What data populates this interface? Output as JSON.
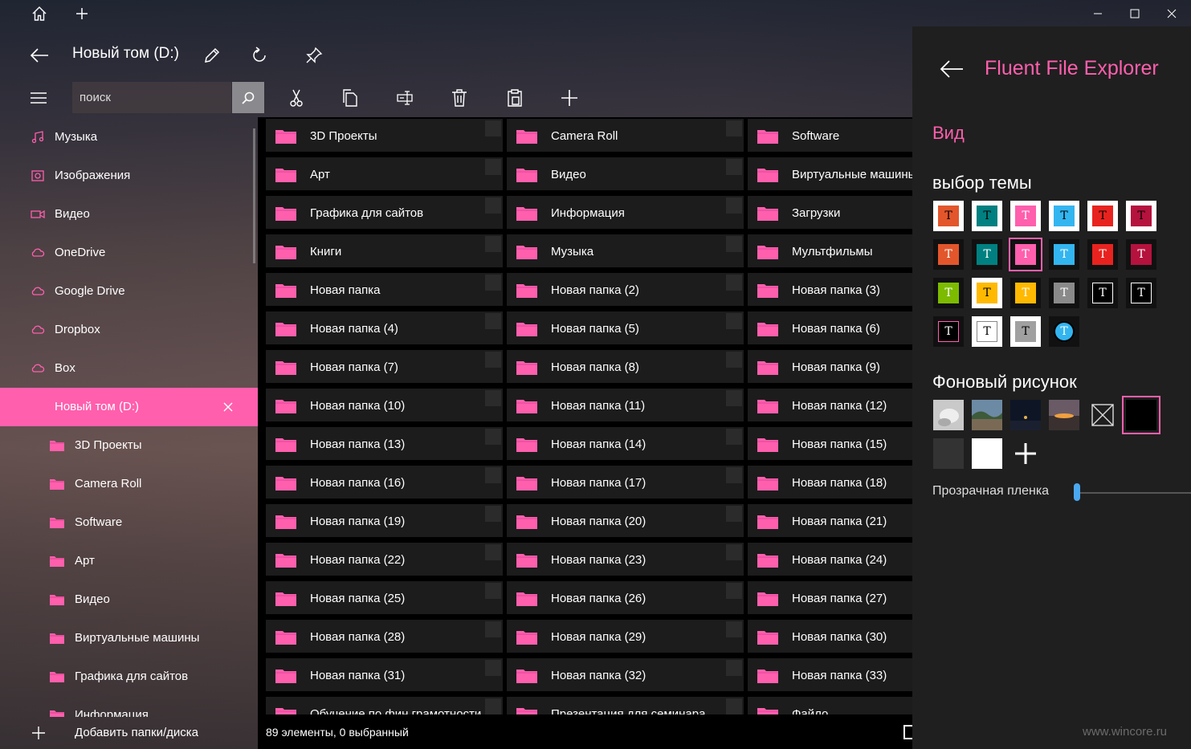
{
  "header": {
    "path_title": "Новый том (D:)"
  },
  "toolbar": {
    "search_placeholder": "поиск"
  },
  "sidebar": {
    "items": [
      {
        "label": "Музыка",
        "icon": "music-icon"
      },
      {
        "label": "Изображения",
        "icon": "pictures-icon"
      },
      {
        "label": "Видео",
        "icon": "video-icon"
      },
      {
        "label": "OneDrive",
        "icon": "cloud-icon"
      },
      {
        "label": "Google Drive",
        "icon": "cloud-icon"
      },
      {
        "label": "Dropbox",
        "icon": "cloud-icon"
      },
      {
        "label": "Box",
        "icon": "cloud-icon"
      },
      {
        "label": "Новый том (D:)",
        "icon": "drive-icon",
        "active": true
      },
      {
        "label": "3D Проекты",
        "icon": "folder-icon"
      },
      {
        "label": "Camera Roll",
        "icon": "folder-icon"
      },
      {
        "label": "Software",
        "icon": "folder-icon"
      },
      {
        "label": "Арт",
        "icon": "folder-icon"
      },
      {
        "label": "Видео",
        "icon": "folder-icon"
      },
      {
        "label": "Виртуальные машины",
        "icon": "folder-icon"
      },
      {
        "label": "Графика для сайтов",
        "icon": "folder-icon"
      },
      {
        "label": "Информация",
        "icon": "folder-icon"
      }
    ],
    "add_label": "Добавить папки/диска"
  },
  "folders": [
    "3D Проекты",
    "Camera Roll",
    "Software",
    "Арт",
    "Видео",
    "Виртуальные машины",
    "Графика для сайтов",
    "Информация",
    "Загрузки",
    "Книги",
    "Музыка",
    "Мультфильмы",
    "Новая папка",
    "Новая папка (2)",
    "Новая папка (3)",
    "Новая папка (4)",
    "Новая папка (5)",
    "Новая папка (6)",
    "Новая папка (7)",
    "Новая папка (8)",
    "Новая папка (9)",
    "Новая папка (10)",
    "Новая папка (11)",
    "Новая папка (12)",
    "Новая папка (13)",
    "Новая папка (14)",
    "Новая папка (15)",
    "Новая папка (16)",
    "Новая папка (17)",
    "Новая папка (18)",
    "Новая папка (19)",
    "Новая папка (20)",
    "Новая папка (21)",
    "Новая папка (22)",
    "Новая папка (23)",
    "Новая папка (24)",
    "Новая папка (25)",
    "Новая папка (26)",
    "Новая папка (27)",
    "Новая папка (28)",
    "Новая папка (29)",
    "Новая папка (30)",
    "Новая папка (31)",
    "Новая папка (32)",
    "Новая папка (33)",
    "Обучение по фин.грамотности",
    "Презентация для семинара",
    "Файло"
  ],
  "status": {
    "text": "89 элементы, 0 выбранный"
  },
  "panel": {
    "title": "Fluent File Explorer",
    "section": "Вид",
    "theme_heading": "выбор темы",
    "background_heading": "Фоновый рисунок",
    "transparency_label": "Прозрачная пленка",
    "transparency_value": 0.02,
    "watermark": "www.wincore.ru",
    "theme_glyph": "T",
    "themes": [
      {
        "bg": "#ffffff",
        "fill": "#e3562b",
        "text": "#000000"
      },
      {
        "bg": "#ffffff",
        "fill": "#008080",
        "text": "#000000"
      },
      {
        "bg": "#ffffff",
        "fill": "#ff5fad",
        "text": "#ffffff"
      },
      {
        "bg": "#ffffff",
        "fill": "#33b5f0",
        "text": "#000000"
      },
      {
        "bg": "#ffffff",
        "fill": "#e8231f",
        "text": "#000000"
      },
      {
        "bg": "#ffffff",
        "fill": "#b5123e",
        "text": "#000000"
      },
      {
        "bg": "#111111",
        "fill": "#e3562b",
        "text": "#ffffff"
      },
      {
        "bg": "#111111",
        "fill": "#008080",
        "text": "#ffffff"
      },
      {
        "bg": "#111111",
        "fill": "#ff5fad",
        "text": "#ffffff",
        "selected": true
      },
      {
        "bg": "#111111",
        "fill": "#33b5f0",
        "text": "#ffffff"
      },
      {
        "bg": "#111111",
        "fill": "#e8231f",
        "text": "#ffffff"
      },
      {
        "bg": "#111111",
        "fill": "#b5123e",
        "text": "#ffffff"
      },
      {
        "bg": "#111111",
        "fill": "#7cbb00",
        "text": "#ffffff"
      },
      {
        "bg": "#ffffff",
        "fill": "#ffb900",
        "text": "#000000"
      },
      {
        "bg": "#111111",
        "fill": "#ffb900",
        "text": "#ffffff"
      },
      {
        "bg": "#111111",
        "fill": "#8a8a8a",
        "text": "#ffffff"
      },
      {
        "bg": "#111111",
        "fill": "#000000",
        "text": "#ffffff",
        "border": "#ffffff"
      },
      {
        "bg": "#111111",
        "fill": "#000000",
        "text": "#ffffff",
        "border": "#ffffff"
      },
      {
        "bg": "#111111",
        "fill": "#000000",
        "text": "#ffffff",
        "border": "#ff5fad"
      },
      {
        "bg": "#ffffff",
        "fill": "#ffffff",
        "text": "#000000",
        "border": "#888888"
      },
      {
        "bg": "#ffffff",
        "fill": "#a0a0a0",
        "text": "#000000"
      },
      {
        "bg": "#111111",
        "fill": "#33b5f0",
        "text": "#ffffff",
        "round": true
      }
    ],
    "backgrounds": [
      {
        "kind": "image-light",
        "icon": "wallpaper-white-icon"
      },
      {
        "kind": "image-beach",
        "icon": "wallpaper-beach-icon"
      },
      {
        "kind": "image-night",
        "icon": "wallpaper-night-icon"
      },
      {
        "kind": "image-sunset",
        "icon": "wallpaper-sunset-icon"
      },
      {
        "kind": "none",
        "icon": "no-image-icon"
      },
      {
        "kind": "black",
        "icon": "solid-black-icon",
        "selected": true
      },
      {
        "kind": "dark",
        "icon": "solid-dark-icon"
      },
      {
        "kind": "white",
        "icon": "solid-white-icon"
      },
      {
        "kind": "add",
        "icon": "plus-icon"
      }
    ]
  },
  "colors": {
    "accent": "#ff5fad",
    "panel_bg": "#1f1f1f",
    "tile_bg": "#1c1c1c",
    "slider_accent": "#4aa8f0"
  }
}
